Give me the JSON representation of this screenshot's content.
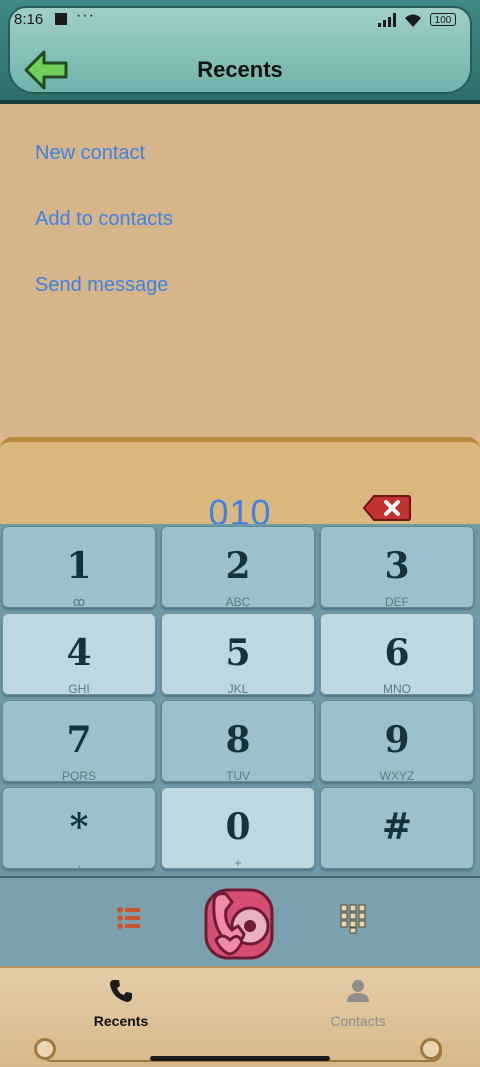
{
  "status_bar": {
    "time": "8:16",
    "overflow": "···",
    "battery": "100"
  },
  "header": {
    "title": "Recents",
    "back_icon": "arrow-left-icon"
  },
  "menu": {
    "items": [
      {
        "label": "New contact"
      },
      {
        "label": "Add to contacts"
      },
      {
        "label": "Send message"
      }
    ]
  },
  "dialer": {
    "number": "010",
    "delete_icon": "backspace-icon",
    "keys": [
      {
        "digit": "1",
        "letters": "ꝏ"
      },
      {
        "digit": "2",
        "letters": "ABC"
      },
      {
        "digit": "3",
        "letters": "DEF"
      },
      {
        "digit": "4",
        "letters": "GHI"
      },
      {
        "digit": "5",
        "letters": "JKL"
      },
      {
        "digit": "6",
        "letters": "MNO"
      },
      {
        "digit": "7",
        "letters": "PQRS"
      },
      {
        "digit": "8",
        "letters": "TUV"
      },
      {
        "digit": "9",
        "letters": "WXYZ"
      },
      {
        "digit": "*",
        "letters": ","
      },
      {
        "digit": "0",
        "letters": "+"
      },
      {
        "digit": "#",
        "letters": ""
      }
    ]
  },
  "actions": {
    "list_icon": "list-icon",
    "call_icon": "phone-call-icon",
    "dialpad_icon": "dialpad-icon"
  },
  "bottom_nav": {
    "items": [
      {
        "label": "Recents",
        "icon": "phone-icon",
        "active": true
      },
      {
        "label": "Contacts",
        "icon": "person-icon",
        "active": false
      }
    ]
  },
  "colors": {
    "accent": "#3d82e6",
    "header": "#6fb3aa",
    "keypad": "#6f9aa8"
  }
}
